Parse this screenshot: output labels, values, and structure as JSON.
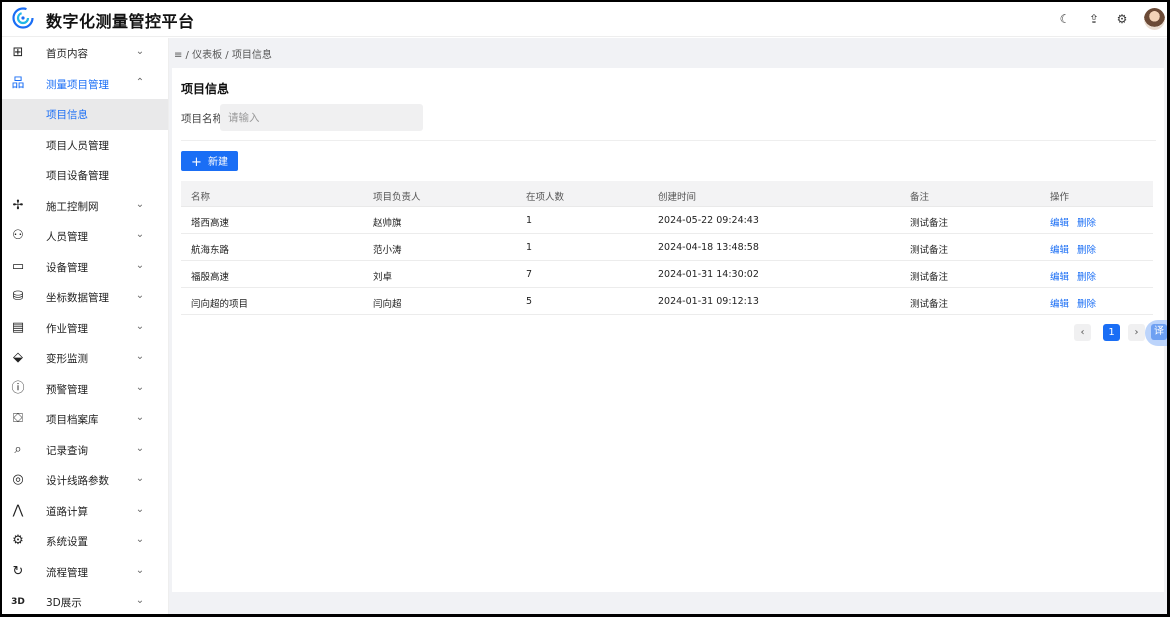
{
  "header": {
    "app_title": "数字化测量管控平台",
    "icons": [
      "theme-toggle-icon",
      "upload-icon",
      "settings-icon"
    ],
    "accent": "#1a6ef5"
  },
  "sidebar": {
    "items": [
      {
        "label": "首页内容",
        "icon": "dashboard-icon",
        "glyph": "⊞",
        "chevron": "⌄"
      },
      {
        "label": "测量项目管理",
        "icon": "org-tree-icon",
        "glyph": "品",
        "chevron": "⌃"
      },
      {
        "label": "施工控制网",
        "icon": "crosshair-icon",
        "glyph": "✢",
        "chevron": "⌄"
      },
      {
        "label": "人员管理",
        "icon": "people-icon",
        "glyph": "⚇",
        "chevron": "⌄"
      },
      {
        "label": "设备管理",
        "icon": "monitor-icon",
        "glyph": "▭",
        "chevron": "⌄"
      },
      {
        "label": "坐标数据管理",
        "icon": "database-icon",
        "glyph": "⛁",
        "chevron": "⌄"
      },
      {
        "label": "作业管理",
        "icon": "document-icon",
        "glyph": "▤",
        "chevron": "⌄"
      },
      {
        "label": "变形监测",
        "icon": "satellite-icon",
        "glyph": "⬙",
        "chevron": "⌄"
      },
      {
        "label": "预警管理",
        "icon": "alert-icon",
        "glyph": "ⓘ",
        "chevron": "⌄"
      },
      {
        "label": "项目档案库",
        "icon": "archive-icon",
        "glyph": "⛋",
        "chevron": "⌄"
      },
      {
        "label": "记录查询",
        "icon": "record-search-icon",
        "glyph": "⌕",
        "chevron": "⌄"
      },
      {
        "label": "设计线路参数",
        "icon": "route-icon",
        "glyph": "◎",
        "chevron": "⌄"
      },
      {
        "label": "道路计算",
        "icon": "compass-icon",
        "glyph": "⋀",
        "chevron": "⌄"
      },
      {
        "label": "系统设置",
        "icon": "gear-icon",
        "glyph": "⚙",
        "chevron": "⌄"
      },
      {
        "label": "流程管理",
        "icon": "flow-icon",
        "glyph": "↻",
        "chevron": "⌄"
      },
      {
        "label": "3D展示",
        "icon": "3d-icon",
        "glyph": "3D",
        "chevron": "⌄"
      }
    ],
    "sub_items": [
      "项目信息",
      "项目人员管理",
      "项目设备管理"
    ]
  },
  "breadcrumb": "≡ / 仪表板 / 项目信息",
  "main": {
    "title": "项目信息",
    "search_label": "项目名称",
    "search_placeholder": "请输入",
    "new_button": "新建",
    "table": {
      "headers": [
        "名称",
        "项目负责人",
        "在项人数",
        "创建时间",
        "备注",
        "操作"
      ],
      "rows": [
        [
          "塔西高速",
          "赵帅旗",
          "1",
          "2024-05-22 09:24:43",
          "测试备注"
        ],
        [
          "航海东路",
          "范小涛",
          "1",
          "2024-04-18 13:48:58",
          "测试备注"
        ],
        [
          "福殷高速",
          "刘卓",
          "7",
          "2024-01-31 14:30:02",
          "测试备注"
        ],
        [
          "闫向超的项目",
          "闫向超",
          "5",
          "2024-01-31 09:12:13",
          "测试备注"
        ]
      ],
      "actions": [
        "编辑",
        "删除"
      ]
    },
    "pagination": {
      "prev": "‹",
      "current": "1",
      "next": "›"
    },
    "translate_label": "译"
  }
}
